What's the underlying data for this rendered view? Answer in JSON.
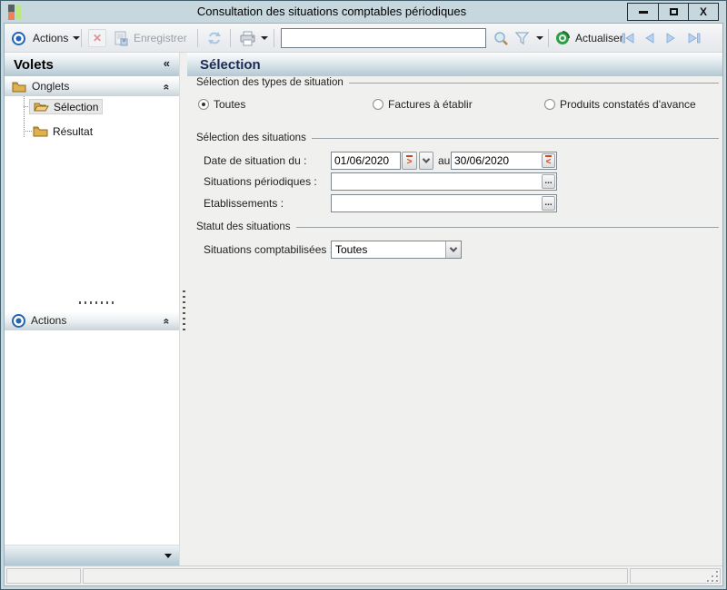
{
  "window": {
    "title": "Consultation des situations comptables périodiques",
    "minimize_glyph": "–",
    "maximize_glyph": "□",
    "close_glyph": "X"
  },
  "toolbar": {
    "actions_label": "Actions",
    "save_label": "Enregistrer",
    "search_value": "",
    "actualiser_label": "Actualiser"
  },
  "icons": {
    "collapse_left": "«",
    "group_chevron": "«"
  },
  "controls": {
    "date_next": ">",
    "date_prev": "<",
    "browse": "..."
  },
  "sidebar": {
    "title": "Volets",
    "onglets_label": "Onglets",
    "items": [
      {
        "label": "Sélection",
        "selected": true
      },
      {
        "label": "Résultat",
        "selected": false
      }
    ],
    "actions_label": "Actions"
  },
  "main": {
    "title": "Sélection",
    "types_legend": "Sélection des types de situation",
    "radios": [
      {
        "label": "Toutes",
        "checked": true
      },
      {
        "label": "Factures à établir",
        "checked": false
      },
      {
        "label": "Produits constatés d'avance",
        "checked": false
      }
    ],
    "situations_legend": "Sélection des situations",
    "date_label": "Date de situation du :",
    "date_from": "01/06/2020",
    "au_label": "au",
    "date_to": "30/06/2020",
    "periodiques_label": "Situations périodiques :",
    "periodiques_value": "",
    "etablissements_label": "Etablissements :",
    "etablissements_value": "",
    "statut_legend": "Statut des situations",
    "comptabilisees_label": "Situations comptabilisées :",
    "comptabilisees_value": "Toutes"
  },
  "colors": {
    "titlebar": "#c7d7de",
    "header_gradient_end": "#b2c8d3",
    "accent_orange": "#cc4a22",
    "folder_gold": "#e3b04e",
    "nav_arrow_blue": "#b9d3ee",
    "refresh_green": "#2f9e44",
    "main_bg": "#f0f0ee"
  }
}
